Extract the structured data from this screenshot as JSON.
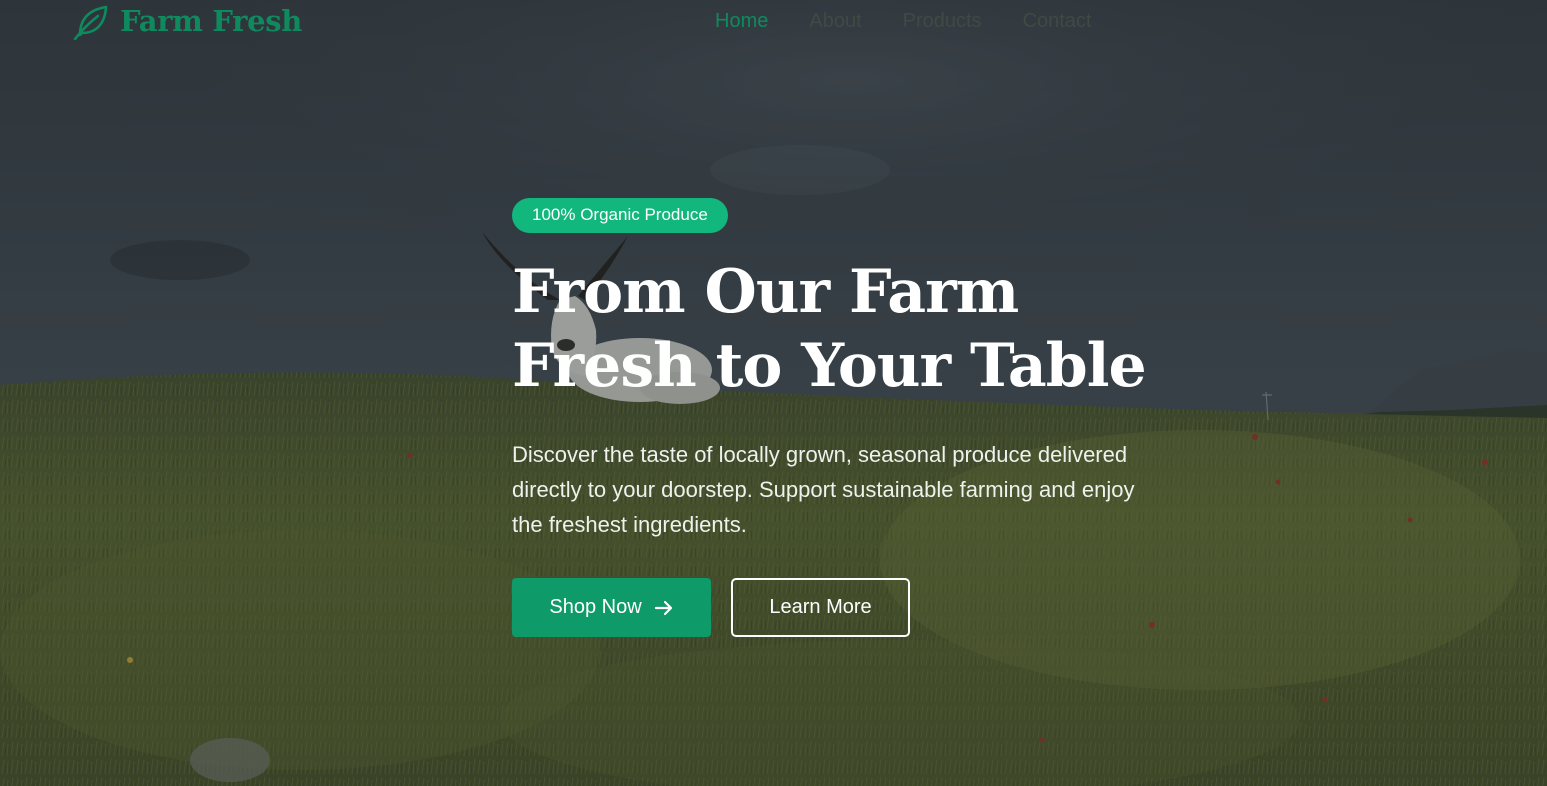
{
  "brand": {
    "name": "Farm Fresh",
    "logo_icon": "leaf-icon",
    "accent_color": "#0f8a5e"
  },
  "nav": {
    "items": [
      {
        "label": "Home",
        "active": true
      },
      {
        "label": "About",
        "active": false
      },
      {
        "label": "Products",
        "active": false
      },
      {
        "label": "Contact",
        "active": false
      }
    ]
  },
  "hero": {
    "badge": "100% Organic Produce",
    "badge_color": "#12b77e",
    "title_line1": "From Our Farm",
    "title_line2": "Fresh to Your Table",
    "description": "Discover the taste of locally grown, seasonal produce delivered directly to your doorstep. Support sustainable farming and enjoy the freshest ingredients.",
    "primary_button": {
      "label": "Shop Now",
      "icon": "arrow-right-icon",
      "color": "#0f9a6a"
    },
    "secondary_button": {
      "label": "Learn More"
    }
  }
}
